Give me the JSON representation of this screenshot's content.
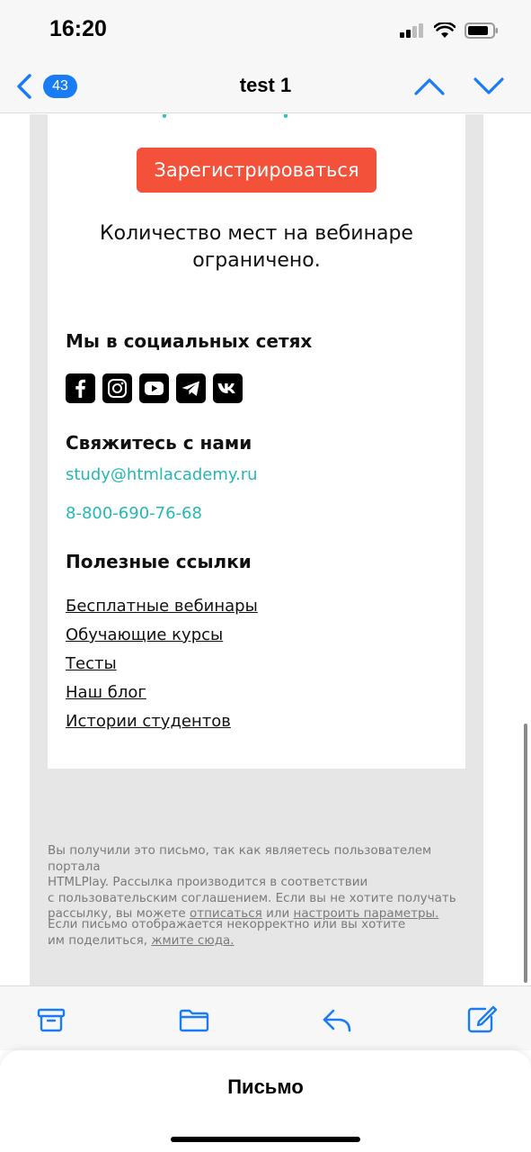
{
  "status": {
    "time": "16:20"
  },
  "nav": {
    "badge": "43",
    "title": "test 1"
  },
  "email": {
    "register_button": "Зарегистрироваться",
    "limit_text_line1": "Количество мест на вебинаре",
    "limit_text_line2": "ограничено.",
    "social": {
      "title": "Мы в социальных сетях",
      "icons": [
        "facebook-icon",
        "instagram-icon",
        "youtube-icon",
        "telegram-icon",
        "vk-icon"
      ]
    },
    "contact": {
      "title": "Свяжитесь с нами",
      "email": "study@htmlacademy.ru",
      "phone": "8-800-690-76-68"
    },
    "links": {
      "title": "Полезные ссылки",
      "items": [
        "Бесплатные вебинары",
        "Обучающие курсы",
        "Тесты",
        "Наш блог",
        "Истории студентов"
      ]
    },
    "footer": {
      "line1": "Вы получили это письмо, так как являетесь пользователем портала",
      "line2": "HTMLPlay. Рассылка производится в соответствии",
      "line3": "с пользовательским соглашением. Если вы не хотите получать",
      "line4_pre": "рассылку, вы можете ",
      "unsubscribe": "отписаться",
      "line4_mid": " или ",
      "settings": "настроить параметры.",
      "line5": "Если письмо отображается некорректно или вы хотите",
      "line6_pre": "им поделиться, ",
      "click_here": "жмите сюда."
    }
  },
  "toolbar": {
    "icons": [
      "archive-icon",
      "folder-icon",
      "reply-icon",
      "compose-icon"
    ]
  },
  "sheet": {
    "title": "Письмо"
  },
  "colors": {
    "accent": "#1a7cf4",
    "button": "#f4513b",
    "link": "#25b8b4"
  }
}
